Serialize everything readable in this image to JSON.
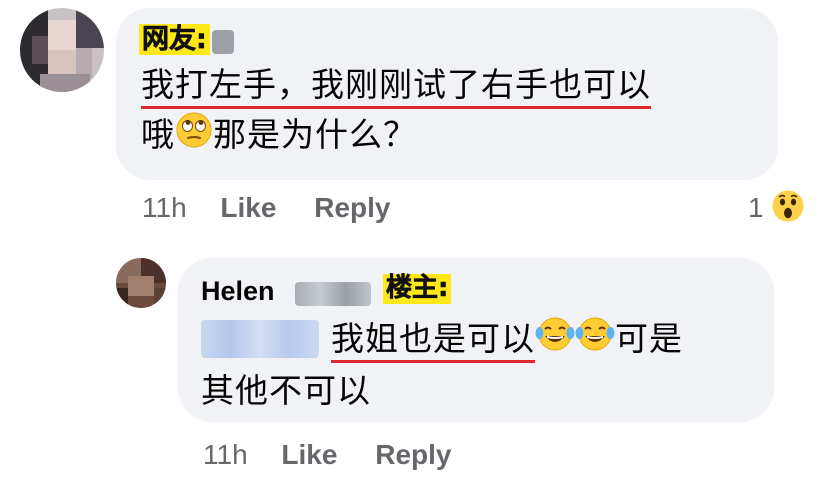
{
  "comment1": {
    "tag": "网友:",
    "line1_underlined": "我打左手，我刚刚试了右手也可以",
    "line2_before_emoji": "哦",
    "line2_after_emoji": "那是为什么？",
    "emoji": "rolling-eyes",
    "time": "11h",
    "like": "Like",
    "reply": "Reply",
    "reaction_count": "1",
    "reaction_emoji": "wow"
  },
  "comment2": {
    "name": "Helen",
    "tag": "楼主:",
    "line1_underlined": "我姐也是可以",
    "line1_after_emoji": "可是",
    "line2": "其他不可以",
    "emoji": "tears-of-joy",
    "time": "11h",
    "like": "Like",
    "reply": "Reply"
  },
  "colors": {
    "bubble": "#f0f2f5",
    "tag_bg": "#ffe81a",
    "underline": "#e0262e",
    "meta_text": "#65676b"
  }
}
